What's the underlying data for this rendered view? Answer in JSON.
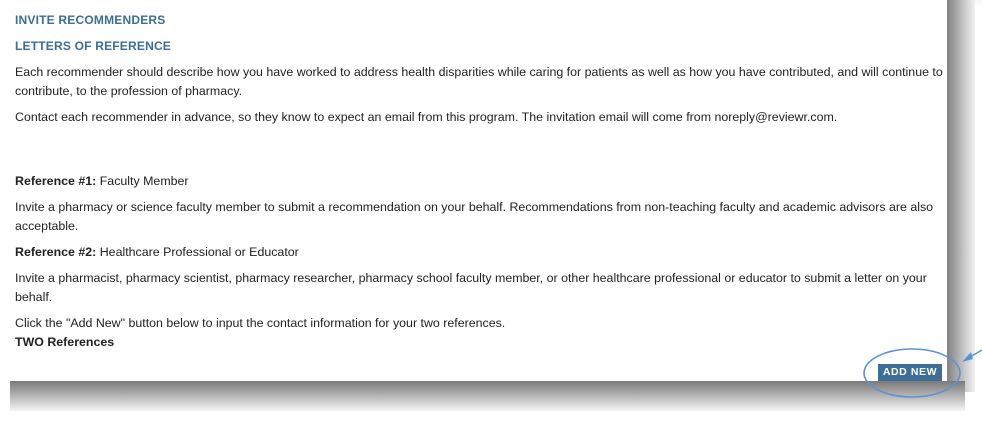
{
  "section": {
    "title": "INVITE RECOMMENDERS",
    "subtitle": "LETTERS OF REFERENCE"
  },
  "intro": {
    "paragraph1": "Each recommender should describe how you have worked to address health disparities while caring for patients as well as how you have contributed, and will continue to contribute, to the profession of pharmacy.",
    "paragraph2": "Contact each recommender in advance, so they know to expect an email from this program. The invitation email will come from noreply@reviewr.com."
  },
  "references": [
    {
      "label": "Reference #1:",
      "type": "Faculty Member",
      "description": "Invite a pharmacy or science faculty member to submit a recommendation on your behalf. Recommendations from non-teaching faculty and academic advisors are also acceptable."
    },
    {
      "label": "Reference #2:",
      "type": "Healthcare Professional or Educator",
      "description": "Invite a pharmacist, pharmacy scientist, pharmacy researcher, pharmacy school faculty member, or other healthcare professional or educator to submit a letter on your behalf."
    }
  ],
  "instruction": "Click the \"Add New\" button below to input the contact information for your two references.",
  "list": {
    "title": "TWO References",
    "add_button_label": "ADD NEW"
  },
  "colors": {
    "accent": "#3c6e96",
    "annotation": "#5b93d1"
  }
}
